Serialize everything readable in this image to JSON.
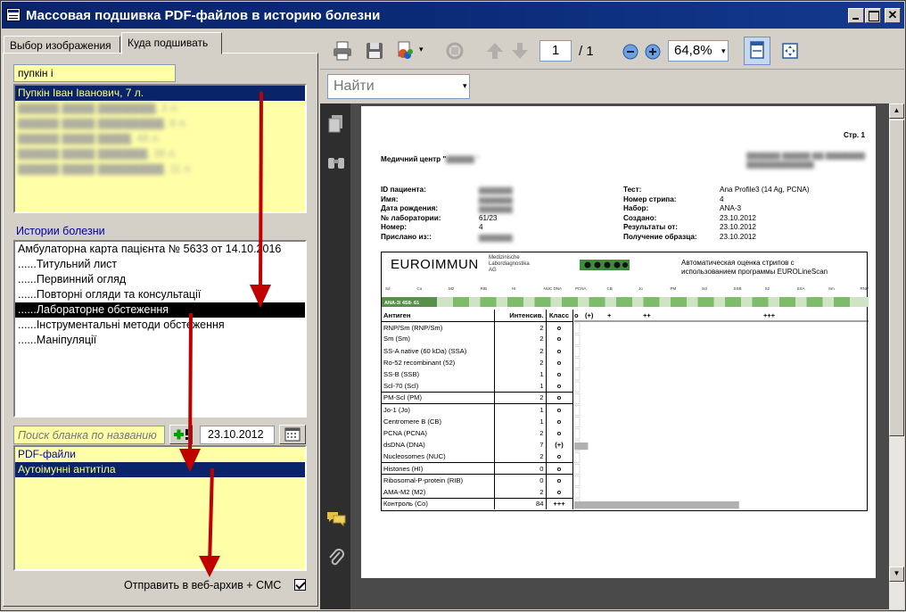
{
  "window": {
    "title": "Массовая подшивка PDF-файлов в историю болезни"
  },
  "tabs": [
    "Выбор изображения",
    "Куда подшивать"
  ],
  "patient_search": {
    "value": "пупкін і"
  },
  "patients": {
    "selected": "Пупкін Іван Іванович, 7 л."
  },
  "history_label": "Истории болезни",
  "history_items": [
    "Амбулаторна карта пацієнта № 5633 от 14.10.2016",
    "......Титульний лист",
    "......Первинний огляд",
    "......Повторні огляди та консультації",
    "......Лабораторне обстеження",
    "......Інструментальні методи обстеження",
    "......Маніпуляції"
  ],
  "blank_search": {
    "placeholder": "Поиск бланка по названию"
  },
  "date_value": "23.10.2012",
  "forms": [
    "PDF-файли",
    "Аутоімунні антитіла"
  ],
  "archive_checkbox_label": "Отправить в веб-архив + СМС",
  "viewer": {
    "page_current": "1",
    "page_total": "/ 1",
    "zoom": "64,8%",
    "find_placeholder": "Найти"
  },
  "document": {
    "page_label": "Стр. 1",
    "center_label": "Медичний центр \"",
    "fields_left": [
      {
        "k": "ID пациента:",
        "v": ""
      },
      {
        "k": "Имя:",
        "v": ""
      },
      {
        "k": "Дата рождения:",
        "v": ""
      },
      {
        "k": "№ лаборатории:",
        "v": "61/23"
      },
      {
        "k": "Номер:",
        "v": "4"
      },
      {
        "k": "Прислано из::",
        "v": ""
      }
    ],
    "fields_right": [
      {
        "k": "Тест:",
        "v": "Ana Profile3 (14 Ag, PCNA)"
      },
      {
        "k": "Номер стрипа:",
        "v": "4"
      },
      {
        "k": "Набор:",
        "v": "ANA-3"
      },
      {
        "k": "Создано:",
        "v": "23.10.2012"
      },
      {
        "k": "Результаты от:",
        "v": "23.10.2012"
      },
      {
        "k": "Получение образца:",
        "v": "23.10.2012"
      }
    ],
    "brand": "EUROIMMUN",
    "brand_sub": [
      "Medizinische",
      "Labordiagnostika",
      "AG"
    ],
    "strip_title": [
      "Автоматическая оценка стрипов с",
      "использованием программы EUROLineScan"
    ],
    "strip_name": "ANA-3/ 4S8- 61",
    "table_headers": [
      "Антиген",
      "Интенсив.",
      "Класс",
      "o",
      "(+)",
      "+",
      "++",
      "+++"
    ],
    "rows": [
      {
        "name": "RNP/Sm (RNP/Sm)",
        "val": "2",
        "cls": "o"
      },
      {
        "name": "Sm (Sm)",
        "val": "2",
        "cls": "o"
      },
      {
        "name": "SS-A native (60 kDa) (SSA)",
        "val": "2",
        "cls": "o"
      },
      {
        "name": "Ro-52 recombinant (52)",
        "val": "2",
        "cls": "o"
      },
      {
        "name": "SS-B (SSB)",
        "val": "1",
        "cls": "o"
      },
      {
        "name": "Scl-70 (Scl)",
        "val": "1",
        "cls": "o"
      },
      {
        "name": "PM-Scl (PM)",
        "val": "2",
        "cls": "o"
      },
      {
        "name": "Jo-1 (Jo)",
        "val": "1",
        "cls": "o"
      },
      {
        "name": "Centromere B (CB)",
        "val": "1",
        "cls": "o"
      },
      {
        "name": "PCNA (PCNA)",
        "val": "2",
        "cls": "o"
      },
      {
        "name": "dsDNA (DNA)",
        "val": "7",
        "cls": "(+)"
      },
      {
        "name": "Nucleosomes (NUC)",
        "val": "2",
        "cls": "o"
      },
      {
        "name": "Histones (HI)",
        "val": "0",
        "cls": "o"
      },
      {
        "name": "Ribosomal-P-protein (RIB)",
        "val": "0",
        "cls": "o"
      },
      {
        "name": "AMA-M2 (M2)",
        "val": "2",
        "cls": "o"
      },
      {
        "name": "Контроль (Co)",
        "val": "84",
        "cls": "+++"
      }
    ],
    "strip_ticks": [
      "Sd",
      "Co",
      "M2",
      "RIB",
      "HI",
      "NUC DNA",
      "PCNA",
      "CB",
      "Jo",
      "PM",
      "Scl",
      "SSB",
      "52",
      "SSA",
      "Sm",
      "RNP/Sm"
    ]
  },
  "colors": {
    "selection": "#0a246a",
    "list_bg": "#ffffa8",
    "arrow": "#c00000"
  }
}
